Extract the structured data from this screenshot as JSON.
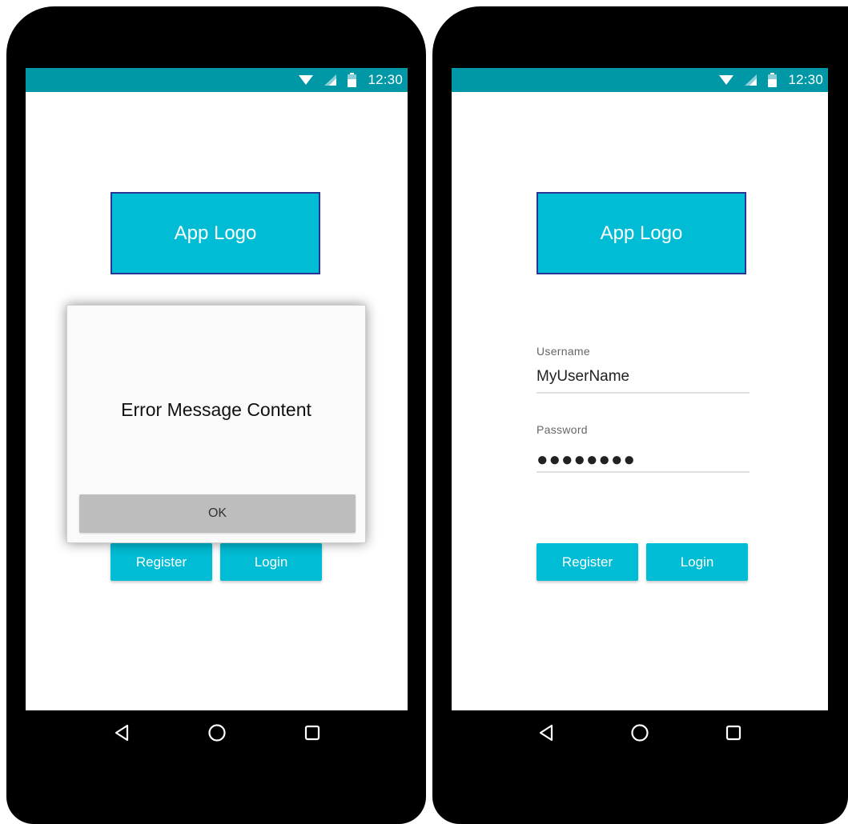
{
  "status_bar": {
    "time": "12:30"
  },
  "left_screen": {
    "logo_text": "App Logo",
    "dialog": {
      "message": "Error Message Content",
      "ok_label": "OK"
    },
    "buttons": {
      "register": "Register",
      "login": "Login"
    }
  },
  "right_screen": {
    "logo_text": "App Logo",
    "username": {
      "label": "Username",
      "value": "MyUserName"
    },
    "password": {
      "label": "Password",
      "value": "●●●●●●●●"
    },
    "buttons": {
      "register": "Register",
      "login": "Login"
    }
  },
  "icons": [
    "wifi-icon",
    "signal-icon",
    "battery-icon",
    "back-icon",
    "home-icon",
    "recents-icon"
  ],
  "colors": {
    "primary": "#00bcd4",
    "status_bar": "#0097a7",
    "logo_border": "#283593",
    "dialog_button": "#bdbdbd"
  }
}
